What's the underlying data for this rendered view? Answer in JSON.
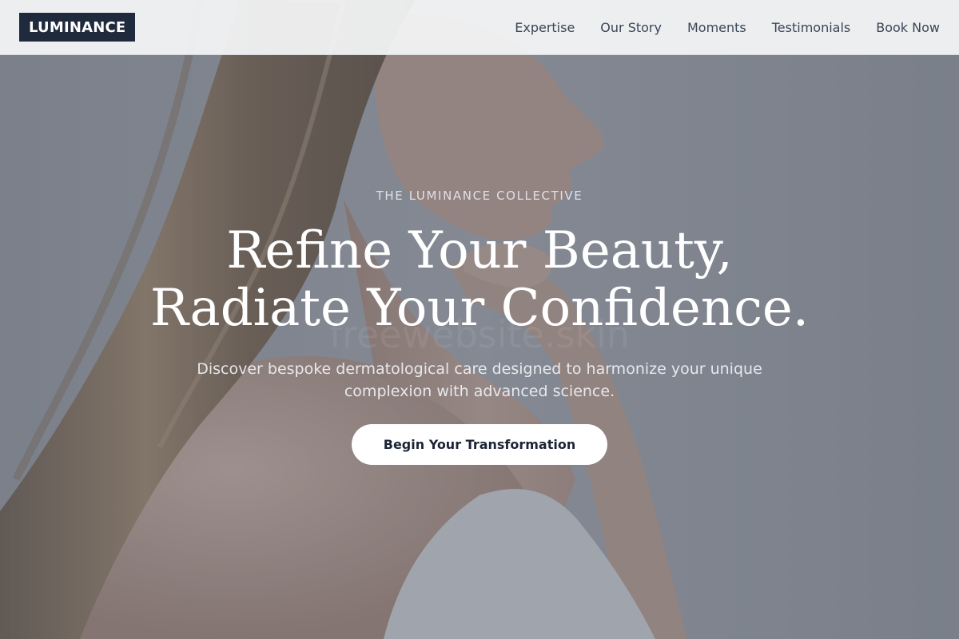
{
  "header": {
    "logo": "LUMINANCE",
    "nav": [
      {
        "label": "Expertise"
      },
      {
        "label": "Our Story"
      },
      {
        "label": "Moments"
      },
      {
        "label": "Testimonials"
      },
      {
        "label": "Book Now"
      }
    ]
  },
  "hero": {
    "eyebrow": "THE LUMINANCE COLLECTIVE",
    "headline_line1": "Refine Your Beauty,",
    "headline_line2": "Radiate Your Confidence.",
    "subcopy": "Discover bespoke dermatological care designed to harmonize your unique complexion with advanced science.",
    "cta_label": "Begin Your Transformation",
    "watermark": "freewebsite.skin"
  },
  "colors": {
    "logo_bg": "#1f2a3d",
    "nav_text": "#3a4658",
    "cta_bg": "#ffffff",
    "cta_text": "#1c2536",
    "overlay": "#3c4250"
  }
}
